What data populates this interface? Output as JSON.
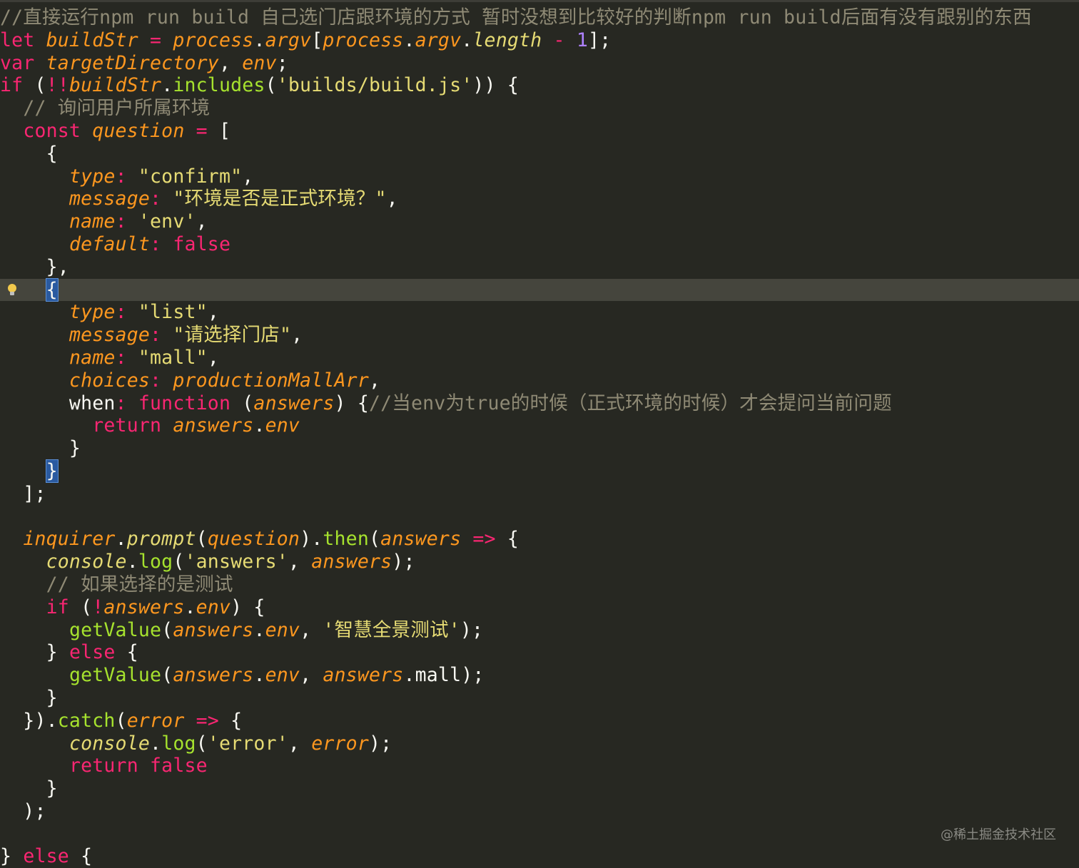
{
  "editor": {
    "theme_colors": {
      "background": "#272822",
      "comment": "#8f8a75",
      "keyword": "#f92672",
      "string": "#e6db74",
      "number": "#ae81ff",
      "function": "#a6e22e",
      "variable": "#fd971f",
      "default": "#f8f8f2",
      "line_highlight": "#45453d",
      "bracket_match": "#2a5aa0"
    },
    "gutter_icon": "lightbulb-icon",
    "highlighted_line": 13,
    "lines": [
      [
        [
          "cm",
          "//直接运行npm run build 自己选门店跟环境的方式 暂时没想到比较好的判断npm run build后面有没有跟别的东西"
        ]
      ],
      [
        [
          "kw",
          "let "
        ],
        [
          "var",
          "buildStr"
        ],
        [
          "pr",
          " "
        ],
        [
          "op",
          "="
        ],
        [
          "pr",
          " "
        ],
        [
          "var",
          "process"
        ],
        [
          "pr",
          "."
        ],
        [
          "var",
          "argv"
        ],
        [
          "pr",
          "["
        ],
        [
          "var",
          "process"
        ],
        [
          "pr",
          "."
        ],
        [
          "var",
          "argv"
        ],
        [
          "pr",
          "."
        ],
        [
          "vi",
          "length"
        ],
        [
          "pr",
          " "
        ],
        [
          "op",
          "-"
        ],
        [
          "pr",
          " "
        ],
        [
          "nu",
          "1"
        ],
        [
          "pr",
          "];"
        ]
      ],
      [
        [
          "kw",
          "var "
        ],
        [
          "var",
          "targetDirectory"
        ],
        [
          "pr",
          ", "
        ],
        [
          "var",
          "env"
        ],
        [
          "pr",
          ";"
        ]
      ],
      [
        [
          "kw",
          "if"
        ],
        [
          "pr",
          " ("
        ],
        [
          "op",
          "!!"
        ],
        [
          "var",
          "buildStr"
        ],
        [
          "pr",
          "."
        ],
        [
          "fn",
          "includes"
        ],
        [
          "pr",
          "("
        ],
        [
          "st",
          "'builds/build.js'"
        ],
        [
          "pr",
          ")) {"
        ]
      ],
      [
        [
          "pr",
          "  "
        ],
        [
          "cm",
          "// 询问用户所属环境"
        ]
      ],
      [
        [
          "pr",
          "  "
        ],
        [
          "kw",
          "const "
        ],
        [
          "var",
          "question"
        ],
        [
          "pr",
          " "
        ],
        [
          "op",
          "="
        ],
        [
          "pr",
          " ["
        ]
      ],
      [
        [
          "pr",
          "    {"
        ]
      ],
      [
        [
          "pr",
          "      "
        ],
        [
          "var",
          "type"
        ],
        [
          "op",
          ":"
        ],
        [
          "pr",
          " "
        ],
        [
          "st",
          "\"confirm\""
        ],
        [
          "pr",
          ","
        ]
      ],
      [
        [
          "pr",
          "      "
        ],
        [
          "var",
          "message"
        ],
        [
          "op",
          ":"
        ],
        [
          "pr",
          " "
        ],
        [
          "st",
          "\"环境是否是正式环境？\""
        ],
        [
          "pr",
          ","
        ]
      ],
      [
        [
          "pr",
          "      "
        ],
        [
          "var",
          "name"
        ],
        [
          "op",
          ":"
        ],
        [
          "pr",
          " "
        ],
        [
          "st",
          "'env'"
        ],
        [
          "pr",
          ","
        ]
      ],
      [
        [
          "pr",
          "      "
        ],
        [
          "var",
          "default"
        ],
        [
          "op",
          ":"
        ],
        [
          "pr",
          " "
        ],
        [
          "kw",
          "false"
        ]
      ],
      [
        [
          "pr",
          "    },"
        ]
      ],
      [
        [
          "pr",
          "    "
        ],
        [
          "bm",
          "{"
        ]
      ],
      [
        [
          "pr",
          "      "
        ],
        [
          "var",
          "type"
        ],
        [
          "op",
          ":"
        ],
        [
          "pr",
          " "
        ],
        [
          "st",
          "\"list\""
        ],
        [
          "pr",
          ","
        ]
      ],
      [
        [
          "pr",
          "      "
        ],
        [
          "var",
          "message"
        ],
        [
          "op",
          ":"
        ],
        [
          "pr",
          " "
        ],
        [
          "st",
          "\"请选择门店\""
        ],
        [
          "pr",
          ","
        ]
      ],
      [
        [
          "pr",
          "      "
        ],
        [
          "var",
          "name"
        ],
        [
          "op",
          ":"
        ],
        [
          "pr",
          " "
        ],
        [
          "st",
          "\"mall\""
        ],
        [
          "pr",
          ","
        ]
      ],
      [
        [
          "pr",
          "      "
        ],
        [
          "var",
          "choices"
        ],
        [
          "op",
          ":"
        ],
        [
          "pr",
          " "
        ],
        [
          "var",
          "productionMallArr"
        ],
        [
          "pr",
          ","
        ]
      ],
      [
        [
          "pr",
          "      when"
        ],
        [
          "op",
          ":"
        ],
        [
          "pr",
          " "
        ],
        [
          "kw",
          "function"
        ],
        [
          "pr",
          " ("
        ],
        [
          "var",
          "answers"
        ],
        [
          "pr",
          ") {"
        ],
        [
          "cm",
          "//当env为true的时候（正式环境的时候）才会提问当前问题"
        ]
      ],
      [
        [
          "pr",
          "        "
        ],
        [
          "kw",
          "return "
        ],
        [
          "var",
          "answers"
        ],
        [
          "pr",
          "."
        ],
        [
          "var",
          "env"
        ]
      ],
      [
        [
          "pr",
          "      }"
        ]
      ],
      [
        [
          "pr",
          "    "
        ],
        [
          "bm",
          "}"
        ]
      ],
      [
        [
          "pr",
          "  ];"
        ]
      ],
      [
        [
          "pr",
          ""
        ]
      ],
      [
        [
          "pr",
          "  "
        ],
        [
          "var",
          "inquirer"
        ],
        [
          "pr",
          "."
        ],
        [
          "vi",
          "prompt"
        ],
        [
          "pr",
          "("
        ],
        [
          "var",
          "question"
        ],
        [
          "pr",
          ")."
        ],
        [
          "fn",
          "then"
        ],
        [
          "pr",
          "("
        ],
        [
          "var",
          "answers"
        ],
        [
          "pr",
          " "
        ],
        [
          "op",
          "=>"
        ],
        [
          "pr",
          " {"
        ]
      ],
      [
        [
          "pr",
          "    "
        ],
        [
          "vi",
          "console"
        ],
        [
          "pr",
          "."
        ],
        [
          "fn",
          "log"
        ],
        [
          "pr",
          "("
        ],
        [
          "st",
          "'answers'"
        ],
        [
          "pr",
          ", "
        ],
        [
          "var",
          "answers"
        ],
        [
          "pr",
          ");"
        ]
      ],
      [
        [
          "pr",
          "    "
        ],
        [
          "cm",
          "// 如果选择的是测试"
        ]
      ],
      [
        [
          "pr",
          "    "
        ],
        [
          "kw",
          "if"
        ],
        [
          "pr",
          " ("
        ],
        [
          "op",
          "!"
        ],
        [
          "var",
          "answers"
        ],
        [
          "pr",
          "."
        ],
        [
          "var",
          "env"
        ],
        [
          "pr",
          ") {"
        ]
      ],
      [
        [
          "pr",
          "      "
        ],
        [
          "fn",
          "getValue"
        ],
        [
          "pr",
          "("
        ],
        [
          "var",
          "answers"
        ],
        [
          "pr",
          "."
        ],
        [
          "var",
          "env"
        ],
        [
          "pr",
          ", "
        ],
        [
          "st",
          "'智慧全景测试'"
        ],
        [
          "pr",
          ");"
        ]
      ],
      [
        [
          "pr",
          "    } "
        ],
        [
          "kw",
          "else"
        ],
        [
          "pr",
          " {"
        ]
      ],
      [
        [
          "pr",
          "      "
        ],
        [
          "fn",
          "getValue"
        ],
        [
          "pr",
          "("
        ],
        [
          "var",
          "answers"
        ],
        [
          "pr",
          "."
        ],
        [
          "var",
          "env"
        ],
        [
          "pr",
          ", "
        ],
        [
          "var",
          "answers"
        ],
        [
          "pr",
          ".mall);"
        ]
      ],
      [
        [
          "pr",
          "    }"
        ]
      ],
      [
        [
          "pr",
          "  })."
        ],
        [
          "fn",
          "catch"
        ],
        [
          "pr",
          "("
        ],
        [
          "var",
          "error"
        ],
        [
          "pr",
          " "
        ],
        [
          "op",
          "=>"
        ],
        [
          "pr",
          " {"
        ]
      ],
      [
        [
          "pr",
          "      "
        ],
        [
          "vi",
          "console"
        ],
        [
          "pr",
          "."
        ],
        [
          "fn",
          "log"
        ],
        [
          "pr",
          "("
        ],
        [
          "st",
          "'error'"
        ],
        [
          "pr",
          ", "
        ],
        [
          "var",
          "error"
        ],
        [
          "pr",
          ");"
        ]
      ],
      [
        [
          "pr",
          "      "
        ],
        [
          "kw",
          "return false"
        ]
      ],
      [
        [
          "pr",
          "    }"
        ]
      ],
      [
        [
          "pr",
          "  );"
        ]
      ],
      [
        [
          "pr",
          ""
        ]
      ],
      [
        [
          "pr",
          "} "
        ],
        [
          "kw",
          "else"
        ],
        [
          "pr",
          " {"
        ]
      ]
    ]
  },
  "watermark": {
    "text": "@稀土掘金技术社区"
  }
}
